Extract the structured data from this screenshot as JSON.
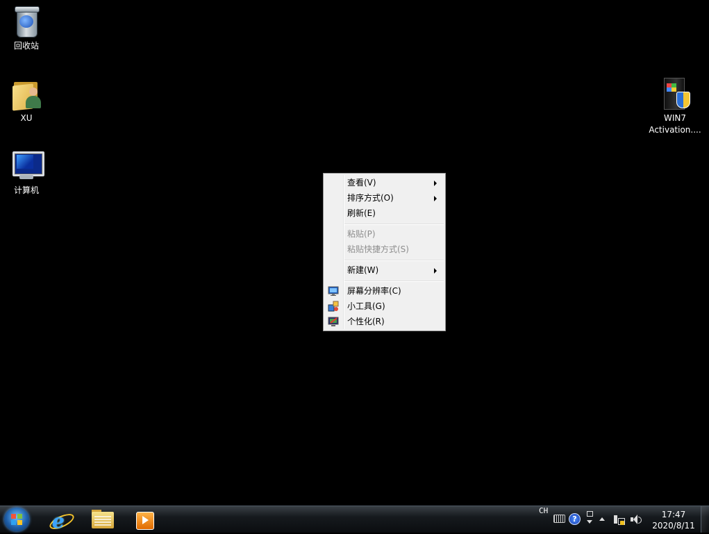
{
  "desktop": {
    "icons": [
      {
        "label": "回收站",
        "icon": "recycle-bin-icon"
      },
      {
        "label": "XU",
        "icon": "user-folder-icon"
      },
      {
        "label": "计算机",
        "icon": "computer-icon"
      },
      {
        "label_line1": "WIN7",
        "label_line2": "Activation....",
        "icon": "activation-app-icon"
      }
    ]
  },
  "context_menu": {
    "items": [
      {
        "label": "查看(V)",
        "submenu": true,
        "enabled": true
      },
      {
        "label": "排序方式(O)",
        "submenu": true,
        "enabled": true
      },
      {
        "label": "刷新(E)",
        "submenu": false,
        "enabled": true
      },
      {
        "label": "粘贴(P)",
        "submenu": false,
        "enabled": false
      },
      {
        "label": "粘贴快捷方式(S)",
        "submenu": false,
        "enabled": false
      },
      {
        "label": "新建(W)",
        "submenu": true,
        "enabled": true
      },
      {
        "label": "屏幕分辨率(C)",
        "submenu": false,
        "enabled": true,
        "icon": "display-icon"
      },
      {
        "label": "小工具(G)",
        "submenu": false,
        "enabled": true,
        "icon": "gadgets-icon"
      },
      {
        "label": "个性化(R)",
        "submenu": false,
        "enabled": true,
        "icon": "personalize-icon"
      }
    ]
  },
  "taskbar": {
    "pinned": [
      "internet-explorer-icon",
      "windows-explorer-icon",
      "media-player-icon"
    ],
    "tray": {
      "language": "CH",
      "time": "17:47",
      "date": "2020/8/11"
    }
  }
}
